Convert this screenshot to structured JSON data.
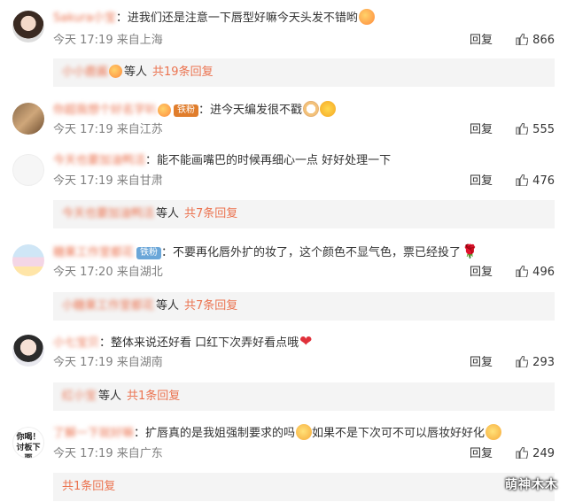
{
  "comments": [
    {
      "username": "Sakura小宝",
      "text": "：进我们还是注意一下唇型好嘛今天头发不错哟",
      "time": "今天 17:19",
      "location": "来自上海",
      "reply_label": "回复",
      "likes": "866",
      "replies": {
        "names": "小小鹿酱",
        "etc": "等人",
        "count_label": "共19条回复"
      }
    },
    {
      "username": "你超我想个好名字叭",
      "badge": "铁粉",
      "text": "：进今天编发很不戳",
      "time": "今天 17:19",
      "location": "来自江苏",
      "reply_label": "回复",
      "likes": "555"
    },
    {
      "username": "今天也要加油鸭活",
      "text": "：能不能画嘴巴的时候再细心一点 好好处理一下",
      "time": "今天 17:19",
      "location": "来自甘肃",
      "reply_label": "回复",
      "likes": "476",
      "replies": {
        "names": "今天也要加油鸭活",
        "etc": "等人",
        "count_label": "共7条回复"
      }
    },
    {
      "username": "糖果工作室都花",
      "badge": "铁粉",
      "text": "：不要再化唇外扩的妆了，这个颜色不显气色，票已经投了",
      "time": "今天 17:20",
      "location": "来自湖北",
      "reply_label": "回复",
      "likes": "496",
      "replies": {
        "names": "小糖果工作室都花",
        "etc": "等人",
        "count_label": "共7条回复"
      }
    },
    {
      "username": "小七宝贝",
      "text": "：整体来说还好看 口红下次弄好看点哦",
      "time": "今天 17:19",
      "location": "来自湖南",
      "reply_label": "回复",
      "likes": "293",
      "replies": {
        "names": "红小宝",
        "etc": "等人",
        "count_label": "共1条回复"
      }
    },
    {
      "username": "了解一下就好嘛",
      "text": "：扩唇真的是我姐强制要求的吗",
      "text2": "如果不是下次可不可以唇妆好好化",
      "time": "今天 17:19",
      "location": "来自广东",
      "reply_label": "回复",
      "likes": "249",
      "replies": {
        "names": "",
        "etc": "",
        "count_label": "共1条回复"
      }
    }
  ],
  "avatar6_text": "你喝！\n讨板下面",
  "watermark": "萌神木木",
  "icons": {
    "like": "thumb-up-icon"
  },
  "colors": {
    "accent": "#eb7350",
    "meta": "#808080",
    "sub_bg": "#f4f4f4"
  }
}
